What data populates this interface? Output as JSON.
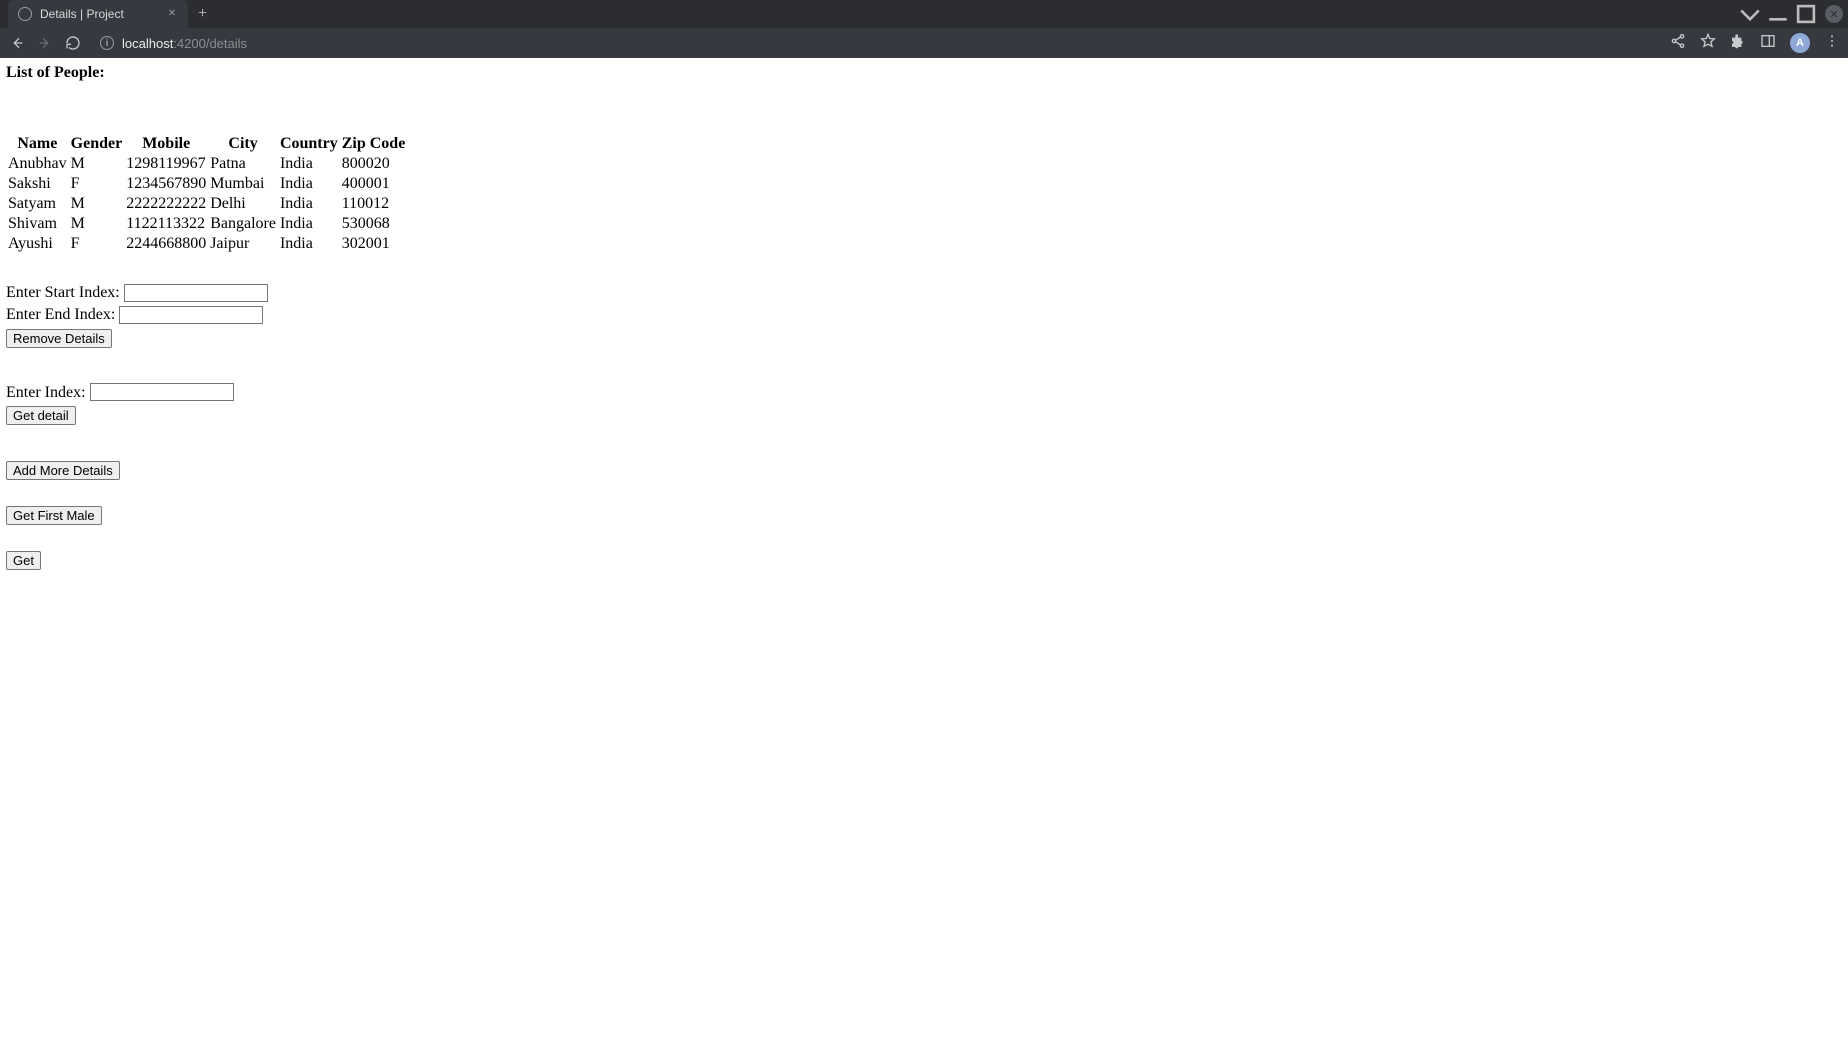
{
  "browser": {
    "tab_title": "Details | Project",
    "url_host": "localhost",
    "url_port_path": ":4200/details",
    "avatar_letter": "A"
  },
  "page": {
    "title": "List of People:",
    "table": {
      "headers": [
        "Name",
        "Gender",
        "Mobile",
        "City",
        "Country",
        "Zip Code"
      ],
      "rows": [
        {
          "name": "Anubhav",
          "gender": "M",
          "mobile": "1298119967",
          "city": "Patna",
          "country": "India",
          "zip": "800020"
        },
        {
          "name": "Sakshi",
          "gender": "F",
          "mobile": "1234567890",
          "city": "Mumbai",
          "country": "India",
          "zip": "400001"
        },
        {
          "name": "Satyam",
          "gender": "M",
          "mobile": "2222222222",
          "city": "Delhi",
          "country": "India",
          "zip": "110012"
        },
        {
          "name": "Shivam",
          "gender": "M",
          "mobile": "1122113322",
          "city": "Bangalore",
          "country": "India",
          "zip": "530068"
        },
        {
          "name": "Ayushi",
          "gender": "F",
          "mobile": "2244668800",
          "city": "Jaipur",
          "country": "India",
          "zip": "302001"
        }
      ]
    },
    "form1": {
      "start_label": "Enter Start Index: ",
      "end_label": "Enter End Index: ",
      "remove_button": "Remove Details"
    },
    "form2": {
      "index_label": "Enter Index: ",
      "get_detail_button": "Get detail"
    },
    "buttons": {
      "add_more": "Add More Details",
      "get_first_male": "Get First Male",
      "get": "Get"
    }
  }
}
